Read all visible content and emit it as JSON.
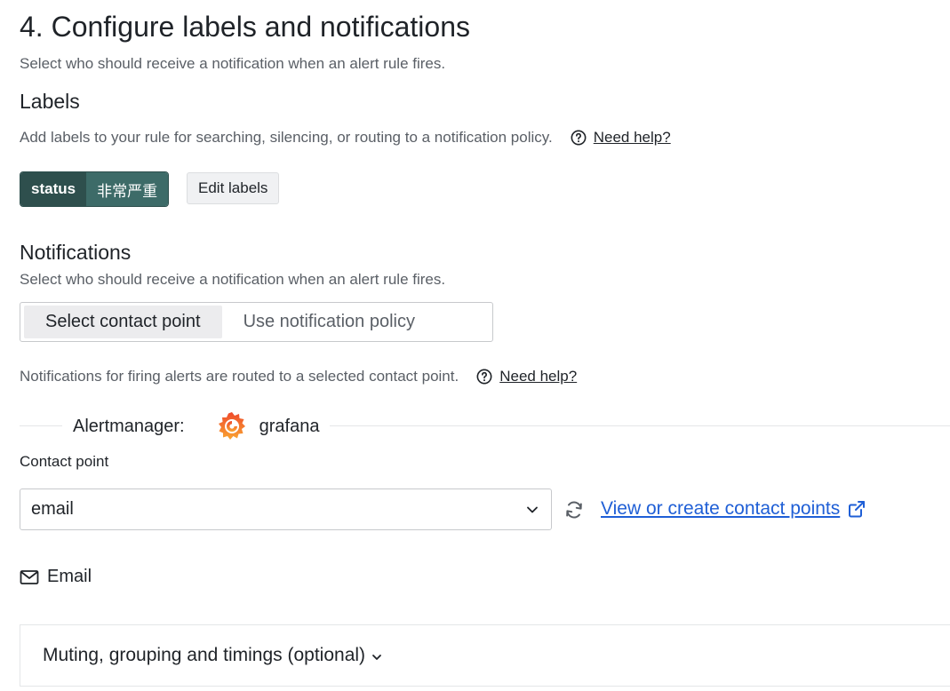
{
  "section": {
    "title": "4. Configure labels and notifications",
    "subtitle": "Select who should receive a notification when an alert rule fires."
  },
  "labels": {
    "heading": "Labels",
    "description": "Add labels to your rule for searching, silencing, or routing to a notification policy.",
    "help_text": "Need help?",
    "items": [
      {
        "key": "status",
        "value": "非常严重"
      }
    ],
    "edit_button": "Edit labels"
  },
  "notifications": {
    "heading": "Notifications",
    "subtitle": "Select who should receive a notification when an alert rule fires.",
    "tabs": [
      {
        "label": "Select contact point",
        "active": true
      },
      {
        "label": "Use notification policy",
        "active": false
      }
    ],
    "description": "Notifications for firing alerts are routed to a selected contact point.",
    "help_text": "Need help?",
    "alertmanager_label": "Alertmanager:",
    "alertmanager_name": "grafana",
    "contact_point_label": "Contact point",
    "contact_point_value": "email",
    "view_link": "View or create contact points",
    "integration": "Email",
    "advanced_toggle": "Muting, grouping and timings (optional)"
  },
  "colors": {
    "label_key_bg": "#2e4f4d",
    "label_value_bg": "#3d6b68",
    "link": "#1f5fd6"
  },
  "icons": {
    "help": "question-circle-icon",
    "chevron": "chevron-down-icon",
    "refresh": "sync-icon",
    "external": "external-link-icon",
    "email": "envelope-icon",
    "logo": "grafana-logo"
  }
}
